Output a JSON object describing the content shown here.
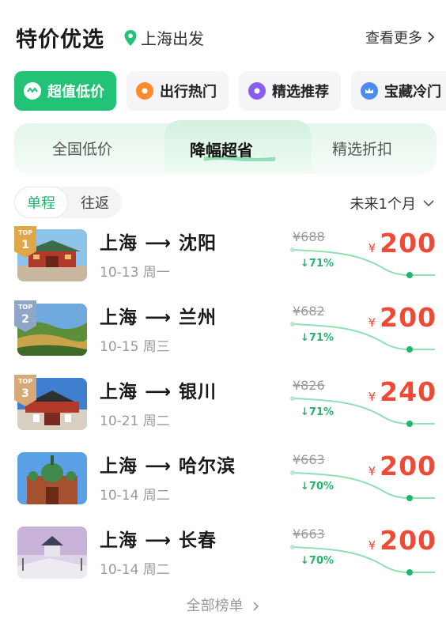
{
  "header": {
    "title": "特价优选",
    "location": "上海出发",
    "more": "查看更多",
    "accent": "#22c277"
  },
  "categories": [
    {
      "label": "超值低价",
      "icon": "coupon-icon",
      "active": true
    },
    {
      "label": "出行热门",
      "icon": "fire-icon",
      "active": false
    },
    {
      "label": "精选推荐",
      "icon": "star-badge-icon",
      "active": false
    },
    {
      "label": "宝藏冷门",
      "icon": "crown-icon",
      "active": false
    }
  ],
  "tabs": [
    {
      "label": "全国低价",
      "active": false
    },
    {
      "label": "降幅超省",
      "active": true
    },
    {
      "label": "精选折扣",
      "active": false
    }
  ],
  "trip_type": {
    "one_way": "单程",
    "round_trip": "往返",
    "selected": "单程"
  },
  "period": "未来1个月",
  "deals": [
    {
      "rank_label": "TOP",
      "rank": "1",
      "route": "上海 ⟶ 沈阳",
      "date": "10-13 周一",
      "old_price": "¥688",
      "drop": "71%",
      "currency": "¥",
      "price": "200",
      "thumb": "palace"
    },
    {
      "rank_label": "TOP",
      "rank": "2",
      "route": "上海 ⟶ 兰州",
      "date": "10-15 周三",
      "old_price": "¥682",
      "drop": "71%",
      "currency": "¥",
      "price": "200",
      "thumb": "hills"
    },
    {
      "rank_label": "TOP",
      "rank": "3",
      "route": "上海 ⟶ 银川",
      "date": "10-21 周二",
      "old_price": "¥826",
      "drop": "71%",
      "currency": "¥",
      "price": "240",
      "thumb": "gate"
    },
    {
      "route": "上海 ⟶ 哈尔滨",
      "date": "10-14 周二",
      "old_price": "¥663",
      "drop": "70%",
      "currency": "¥",
      "price": "200",
      "thumb": "cathedral"
    },
    {
      "route": "上海 ⟶ 长春",
      "date": "10-14 周二",
      "old_price": "¥663",
      "drop": "70%",
      "currency": "¥",
      "price": "200",
      "thumb": "bridge"
    }
  ],
  "footer": {
    "all_rankings": "全部榜单"
  },
  "colors": {
    "price": "#f04a37",
    "drop": "#20b56a",
    "gold": "#e0a64a",
    "silver": "#8fa6c8",
    "bronze": "#d9a877"
  }
}
